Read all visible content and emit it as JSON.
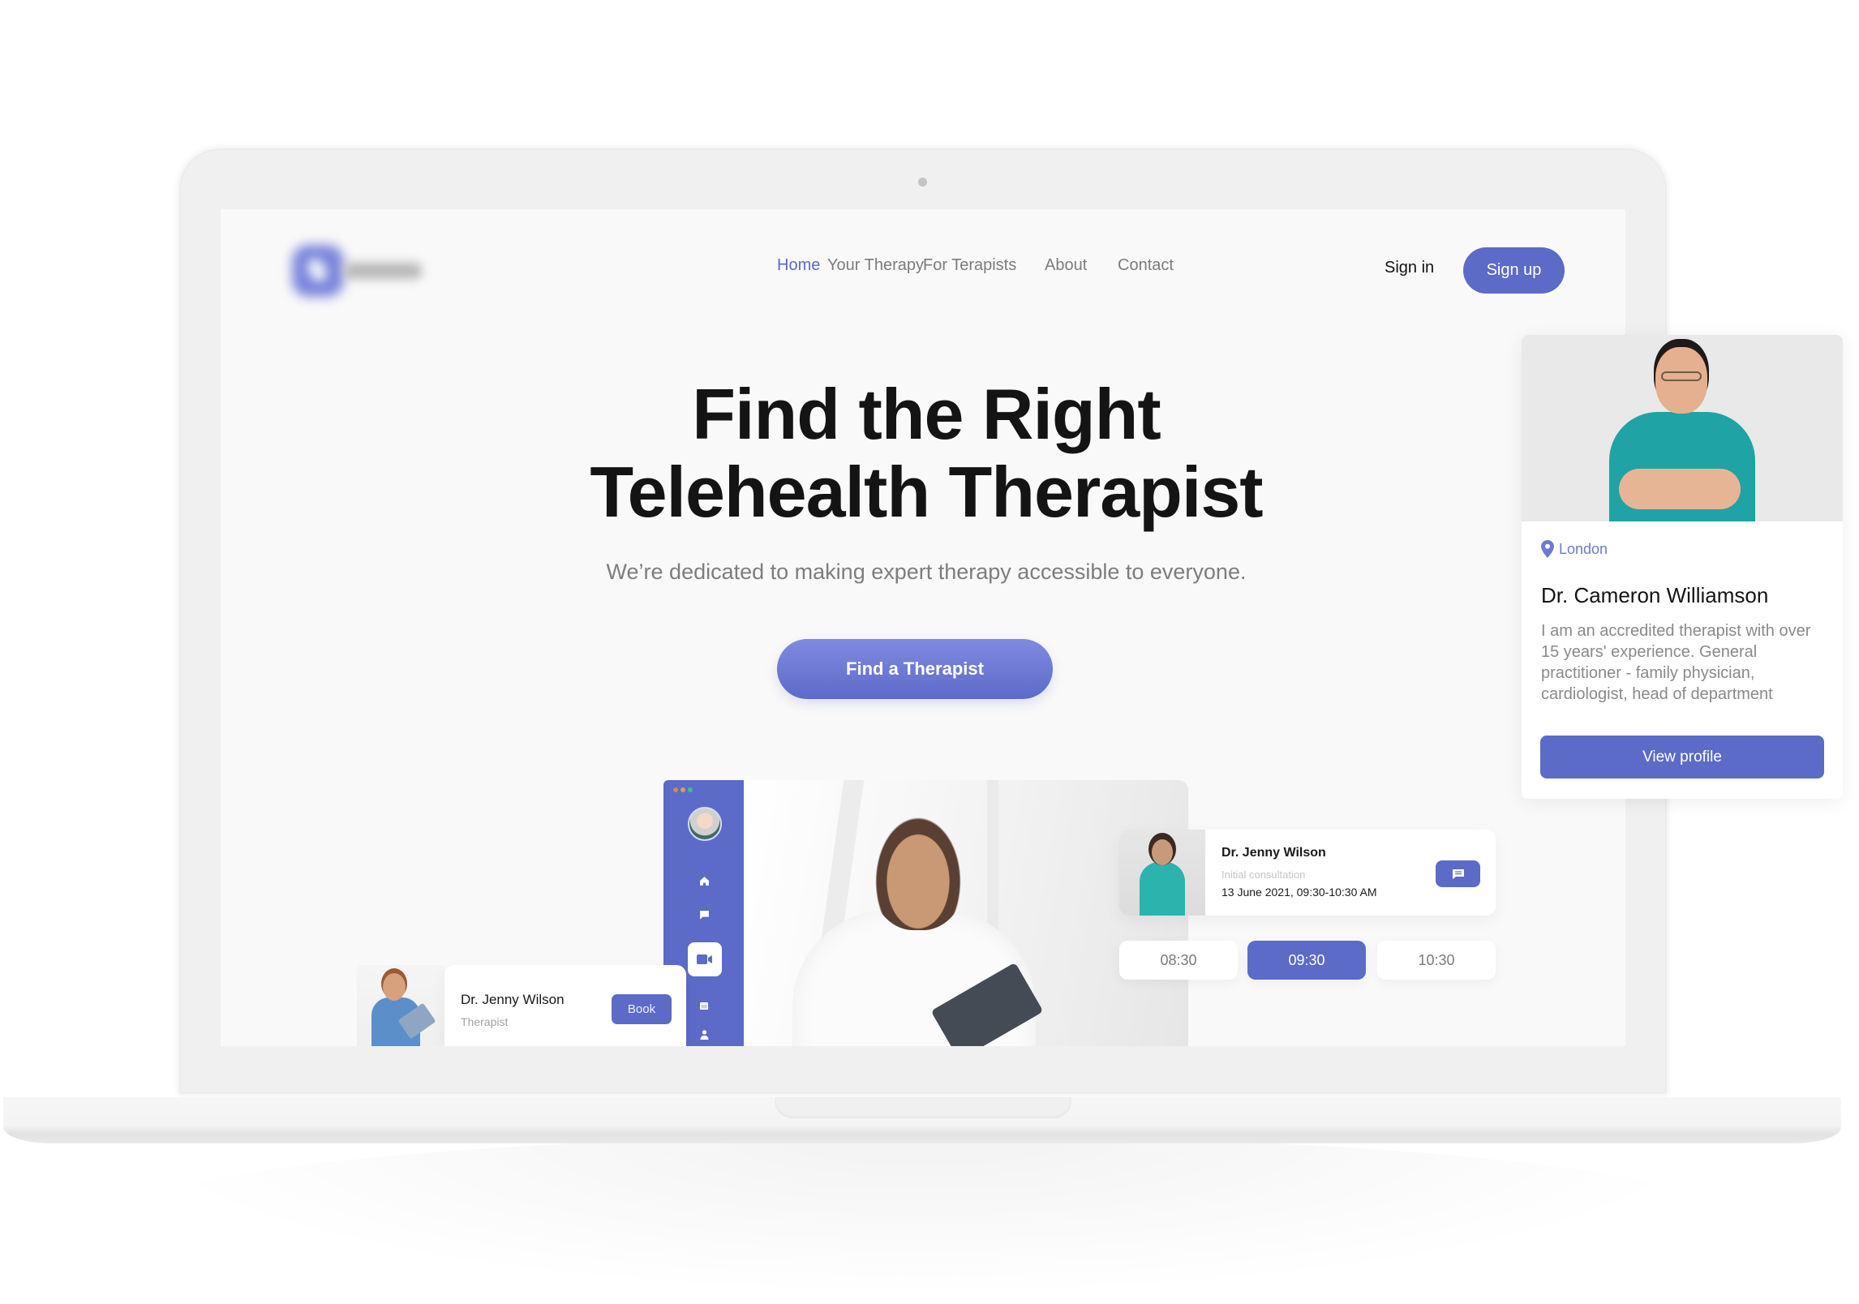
{
  "nav": {
    "items": [
      {
        "label": "Home",
        "active": true
      },
      {
        "label": "Your Therapy",
        "active": false
      },
      {
        "label": "For Terapists",
        "active": false
      },
      {
        "label": "About",
        "active": false
      },
      {
        "label": "Contact",
        "active": false
      }
    ],
    "sign_in": "Sign in",
    "sign_up": "Sign up"
  },
  "hero": {
    "title_line1": "Find the Right",
    "title_line2": "Telehealth Therapist",
    "subtitle": "We’re dedicated to making expert therapy accessible to everyone.",
    "cta": "Find a Therapist"
  },
  "app_mockup": {
    "sidebar_icons": [
      "home-icon",
      "chat-icon",
      "video-icon",
      "calendar-icon",
      "user-icon"
    ],
    "active_icon": "video-icon",
    "appointment": {
      "doctor": "Dr. Jenny Wilson",
      "type": "Initial consultation",
      "datetime": "13 June 2021, 09:30-10:30 AM",
      "message_icon": "message-icon"
    },
    "time_slots": [
      {
        "label": "08:30",
        "selected": false
      },
      {
        "label": "09:30",
        "selected": true
      },
      {
        "label": "10:30",
        "selected": false
      }
    ],
    "therapist_card": {
      "name": "Dr. Jenny Wilson",
      "role": "Therapist",
      "book": "Book"
    }
  },
  "profile_card": {
    "location": "London",
    "name": "Dr. Cameron Williamson",
    "bio": "I am an accredited therapist with over 15 years' experience. General practitioner - family physician, cardiologist, head of department",
    "button": "View profile"
  },
  "colors": {
    "accent": "#5C6BC8",
    "text_dark": "#141414",
    "text_muted": "#7D7D7D"
  }
}
